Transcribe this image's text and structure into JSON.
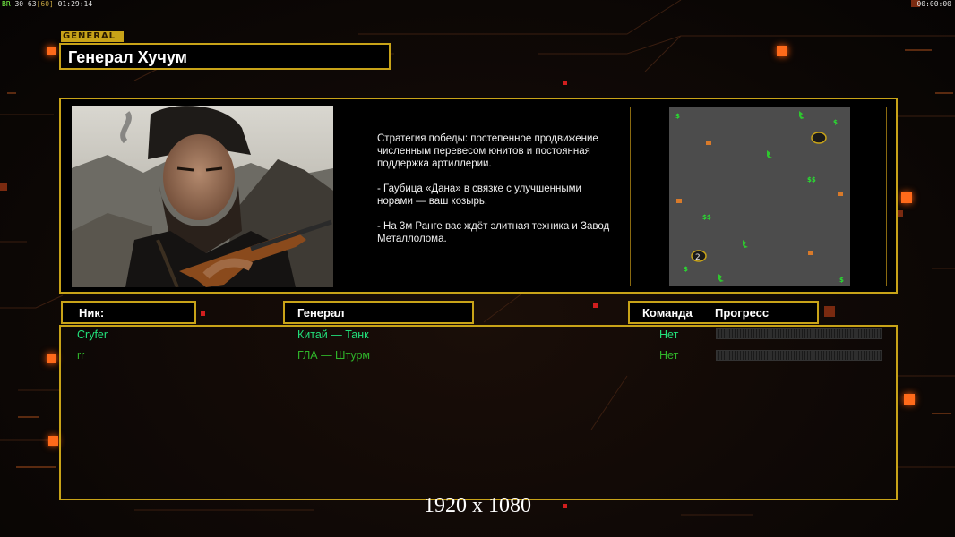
{
  "hud": {
    "left_prefix": "BR",
    "left_stats": "30 63",
    "left_fps": "[60]",
    "left_time": "01:29:14",
    "right_time": "00:00:00"
  },
  "header": {
    "tag": "GENERAL",
    "title": "Генерал Хучум"
  },
  "strategy": {
    "description": "Стратегия победы: постепенное продвижение численным перевесом юнитов и постоянная поддержка артиллерии.\n\n- Гаубица «Дана» в связке с улучшенными норами — ваш козырь.\n\n- На 3м Ранге вас ждёт элитная техника и Завод Металлолома."
  },
  "minimap": {
    "player_marker": "2"
  },
  "columns": {
    "nick": "Ник:",
    "general": "Генерал",
    "team": "Команда",
    "progress": "Прогресс"
  },
  "players": [
    {
      "nick": "Cryfer",
      "general": "Китай — Танк",
      "team": "Нет",
      "color": "#22e07a",
      "progress": 0
    },
    {
      "nick": "rr",
      "general": "ГЛА — Штурм",
      "team": "Нет",
      "color": "#2fb52a",
      "progress": 0
    }
  ],
  "footer": {
    "resolution": "1920 x 1080"
  },
  "colors": {
    "frame": "#c8a318",
    "accent": "#ff6a1a"
  }
}
